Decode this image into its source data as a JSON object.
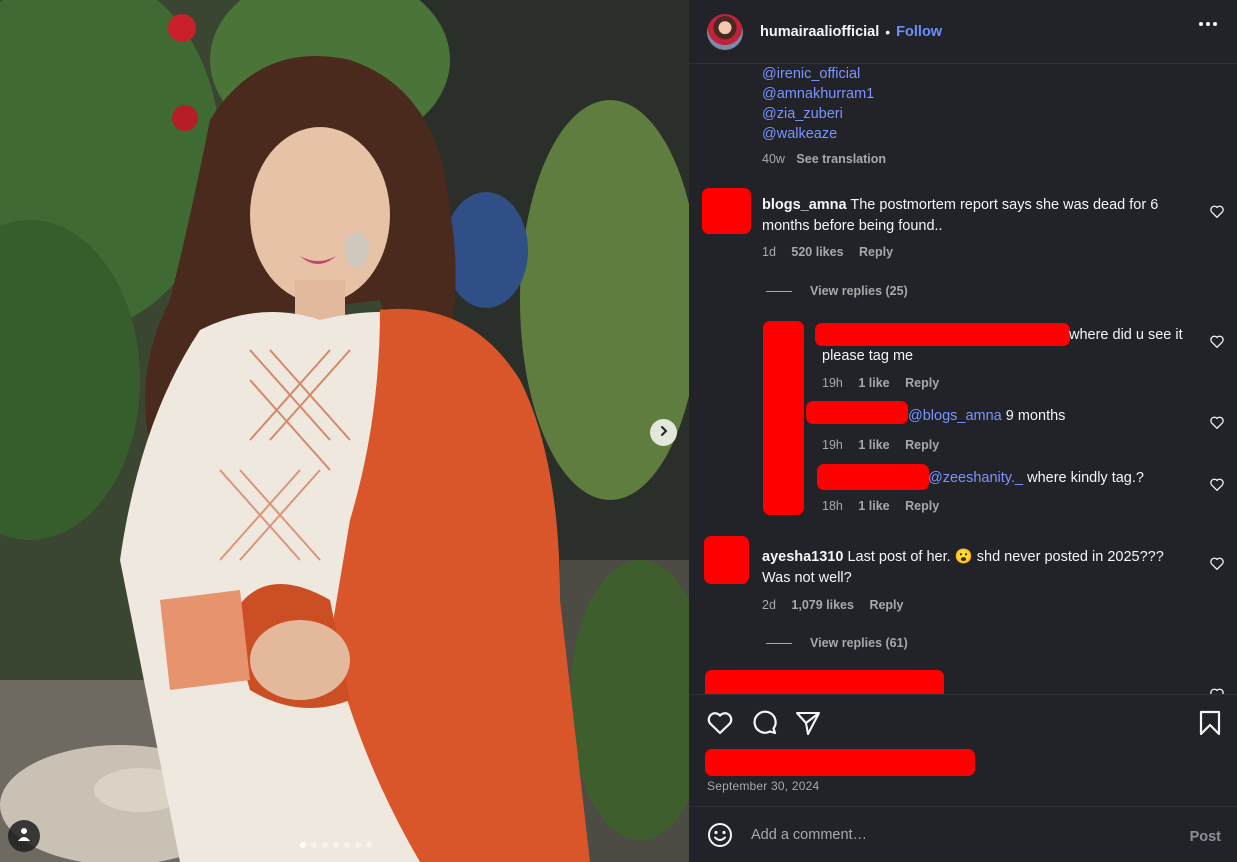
{
  "post": {
    "username": "humairaaliofficial",
    "separator": "•",
    "follow_label": "Follow",
    "date": "September 30, 2024",
    "carousel_dots": 7
  },
  "caption": {
    "mentions": [
      "@irenic_official",
      "@amnakhurram1",
      "@zia_zuberi",
      "@walkeaze"
    ],
    "age": "40w",
    "see_translation": "See translation"
  },
  "comments": [
    {
      "username": "blogs_amna",
      "text_line1": "The postmortem report says she was dead for 6",
      "text_line2": "months before being found..",
      "age": "1d",
      "likes": "520 likes",
      "reply": "Reply",
      "view_replies": "View replies (25)"
    },
    {
      "username": "ayesha1310",
      "text_line1": "Last post of her. 😮 shd never posted in 2025???",
      "text_line2": "Was not well?",
      "age": "2d",
      "likes": "1,079 likes",
      "reply": "Reply",
      "view_replies": "View replies (61)"
    }
  ],
  "replies": [
    {
      "text_line1": "where did u see it",
      "text_line2": "please tag me",
      "age": "19h",
      "likes": "1 like",
      "reply": "Reply"
    },
    {
      "tag": "@blogs_amna",
      "text": " 9 months",
      "age": "19h",
      "likes": "1 like",
      "reply": "Reply"
    },
    {
      "tag": "@zeeshanity._",
      "text": " where kindly tag.?",
      "age": "18h",
      "likes": "1 like",
      "reply": "Reply"
    }
  ],
  "composer": {
    "placeholder": "Add a comment…",
    "post_label": "Post"
  },
  "colors": {
    "panel_bg": "#212328",
    "link_blue": "#7b94ff",
    "redaction": "#ff0000",
    "muted": "#a8a8a8"
  },
  "icons": [
    "next-arrow-icon",
    "user-tag-icon",
    "more-options-icon",
    "heart-icon",
    "comment-icon",
    "share-icon",
    "bookmark-icon",
    "emoji-icon"
  ]
}
